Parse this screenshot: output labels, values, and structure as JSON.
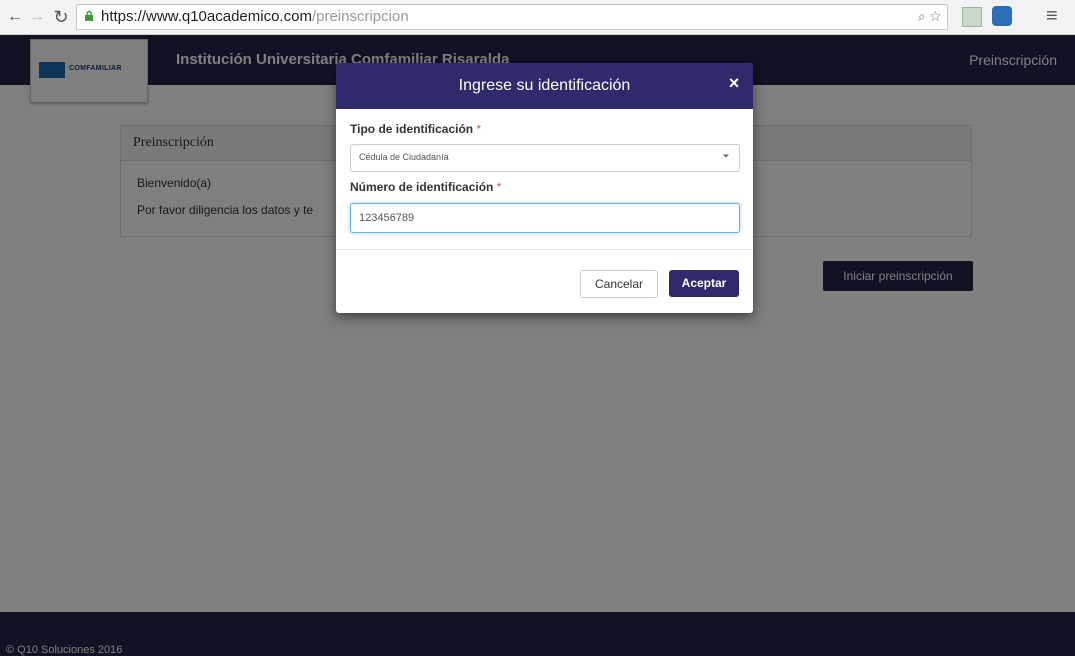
{
  "browser": {
    "url_prefix": "https://",
    "url_host": "www.q10academico.com",
    "url_path": "/preinscripcion",
    "zoom_glyph": "⌕",
    "star_glyph": "☆"
  },
  "header": {
    "logo_text": "COMFAMILIAR",
    "institution_title": "Institución Universitaria Comfamiliar Risaralda",
    "right_link": "Preinscripción"
  },
  "panel": {
    "title": "Preinscripción",
    "welcome": "Bienvenido(a)",
    "message": "Por favor diligencia los datos y te"
  },
  "start_button": "Iniciar preinscripción",
  "footer": {
    "text": "© Q10 Soluciones 2016"
  },
  "modal": {
    "title": "Ingrese su identificación",
    "close_glyph": "×",
    "tipo_label": "Tipo de identificación",
    "tipo_value": "Cédula de Ciudadanía",
    "numero_label": "Número de identificación",
    "numero_value": "123456789",
    "required_mark": "*",
    "cancel_label": "Cancelar",
    "accept_label": "Aceptar"
  },
  "colors": {
    "primary": "#2f2a6b",
    "navbar": "#24244a",
    "required": "#d9534f"
  }
}
